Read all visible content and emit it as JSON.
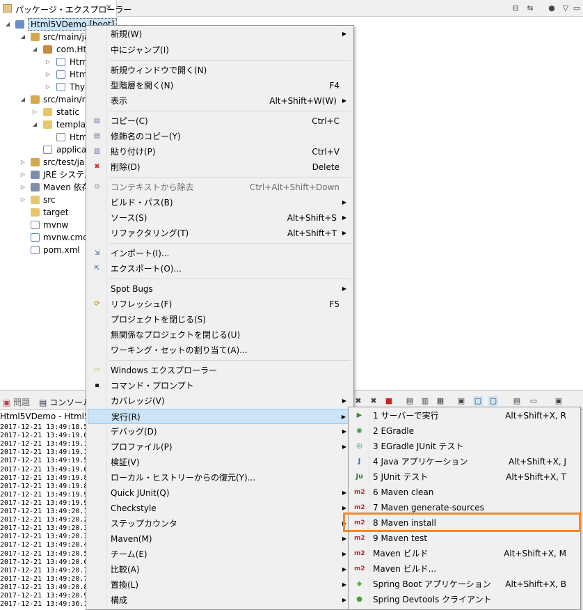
{
  "explorer": {
    "tab_title": "パッケージ・エクスプローラー",
    "tree": [
      {
        "label": "Html5VDemo [boot]",
        "selected": true
      },
      {
        "label": "src/main/ja"
      },
      {
        "label": "com.Htm"
      },
      {
        "label": "Htm"
      },
      {
        "label": "Htm"
      },
      {
        "label": "Thy"
      },
      {
        "label": "src/main/r"
      },
      {
        "label": "static"
      },
      {
        "label": "templa"
      },
      {
        "label": "Htm"
      },
      {
        "label": "applicat"
      },
      {
        "label": "src/test/ja"
      },
      {
        "label": "JRE システム"
      },
      {
        "label": "Maven 依存"
      },
      {
        "label": "src"
      },
      {
        "label": "target"
      },
      {
        "label": "mvnw"
      },
      {
        "label": "mvnw.cmd"
      },
      {
        "label": "pom.xml"
      }
    ]
  },
  "bottom": {
    "tab_problems": "問題",
    "tab_console": "コンソール",
    "console_title": "Html5VDemo - Html5",
    "log_lines": [
      "2017-12-21 13:49:18.5",
      "2017-12-21 13:49:19.0",
      "2017-12-21 13:49:19.1",
      "2017-12-21 13:49:19.1",
      "2017-12-21 13:49:19.5",
      "2017-12-21 13:49:19.6",
      "2017-12-21 13:49:19.8",
      "2017-12-21 13:49:19.8",
      "2017-12-21 13:49:19.9",
      "2017-12-21 13:49:19.9",
      "2017-12-21 13:49:20.1",
      "2017-12-21 13:49:20.2",
      "2017-12-21 13:49:20.3",
      "2017-12-21 13:49:20.3",
      "2017-12-21 13:49:20.4",
      "2017-12-21 13:49:20.5",
      "2017-12-21 13:49:20.6",
      "2017-12-21 13:49:20.7",
      "2017-12-21 13:49:20.7",
      "2017-12-21 13:49:20.8",
      "2017-12-21 13:49:20.9",
      "2017-12-21 13:49:36.1"
    ]
  },
  "context_menu": {
    "items": [
      {
        "label": "新規(W)",
        "submenu": true
      },
      {
        "label": "中にジャンプ(I)"
      },
      {
        "label": "新規ウィンドウで開く(N)"
      },
      {
        "label": "型階層を開く(N)",
        "accel": "F4"
      },
      {
        "label": "表示",
        "accel": "Alt+Shift+W(W)",
        "submenu": true
      },
      {
        "label": "コピー(C)",
        "accel": "Ctrl+C",
        "icon": "copy-icon"
      },
      {
        "label": "修飾名のコピー(Y)",
        "icon": "copy-qualified-icon"
      },
      {
        "label": "貼り付け(P)",
        "accel": "Ctrl+V",
        "icon": "paste-icon"
      },
      {
        "label": "削除(D)",
        "accel": "Delete",
        "icon": "delete-icon"
      },
      {
        "label": "コンテキストから除去",
        "accel": "Ctrl+Alt+Shift+Down",
        "disabled": true,
        "icon": "remove-context-icon"
      },
      {
        "label": "ビルド・パス(B)",
        "submenu": true
      },
      {
        "label": "ソース(S)",
        "accel": "Alt+Shift+S",
        "submenu": true
      },
      {
        "label": "リファクタリング(T)",
        "accel": "Alt+Shift+T",
        "submenu": true
      },
      {
        "label": "インポート(I)...",
        "icon": "import-icon"
      },
      {
        "label": "エクスポート(O)...",
        "icon": "export-icon"
      },
      {
        "label": "Spot Bugs",
        "submenu": true
      },
      {
        "label": "リフレッシュ(F)",
        "accel": "F5",
        "icon": "refresh-icon"
      },
      {
        "label": "プロジェクトを閉じる(S)"
      },
      {
        "label": "無関係なプロジェクトを閉じる(U)"
      },
      {
        "label": "ワーキング・セットの割り当て(A)..."
      },
      {
        "label": "Windows エクスプローラー",
        "icon": "folder-explore-icon"
      },
      {
        "label": "コマンド・プロンプト",
        "icon": "terminal-icon"
      },
      {
        "label": "カバレッジ(V)",
        "submenu": true
      },
      {
        "label": "実行(R)",
        "submenu": true,
        "selected": true
      },
      {
        "label": "デバッグ(D)",
        "submenu": true
      },
      {
        "label": "プロファイル(P)",
        "submenu": true
      },
      {
        "label": "検証(V)"
      },
      {
        "label": "ローカル・ヒストリーからの復元(Y)..."
      },
      {
        "label": "Quick JUnit(Q)",
        "submenu": true
      },
      {
        "label": "Checkstyle",
        "submenu": true
      },
      {
        "label": "ステップカウンタ",
        "submenu": true
      },
      {
        "label": "Maven(M)",
        "submenu": true
      },
      {
        "label": "チーム(E)",
        "submenu": true
      },
      {
        "label": "比較(A)",
        "submenu": true
      },
      {
        "label": "置換(L)",
        "submenu": true
      },
      {
        "label": "構成",
        "submenu": true
      }
    ]
  },
  "run_submenu": {
    "items": [
      {
        "label": "1 サーバーで実行",
        "accel": "Alt+Shift+X, R",
        "icon": "server-run-icon"
      },
      {
        "label": "2 EGradle",
        "icon": "egradle-icon"
      },
      {
        "label": "3 EGradle JUnit テスト",
        "icon": "egradle-junit-icon"
      },
      {
        "label": "4 Java アプリケーション",
        "accel": "Alt+Shift+X, J",
        "icon": "java-app-icon"
      },
      {
        "label": "5 JUnit テスト",
        "accel": "Alt+Shift+X, T",
        "icon": "junit-icon"
      },
      {
        "label": "6 Maven clean",
        "icon": "maven-icon"
      },
      {
        "label": "7 Maven generate-sources",
        "icon": "maven-icon"
      },
      {
        "label": "8 Maven install",
        "icon": "maven-icon",
        "highlighted": true
      },
      {
        "label": "9 Maven test",
        "icon": "maven-icon"
      },
      {
        "label": "Maven ビルド",
        "accel": "Alt+Shift+X, M",
        "icon": "maven-icon"
      },
      {
        "label": "Maven ビルド...",
        "icon": "maven-icon"
      },
      {
        "label": "Spring Boot アプリケーション",
        "accel": "Alt+Shift+X, B",
        "icon": "spring-boot-icon"
      },
      {
        "label": "Spring Devtools クライアント",
        "icon": "spring-devtools-icon"
      }
    ]
  },
  "colors": {
    "highlight_border": "#f08a28",
    "selection_bg": "#cce4f7",
    "maven_red": "#cc2222"
  }
}
